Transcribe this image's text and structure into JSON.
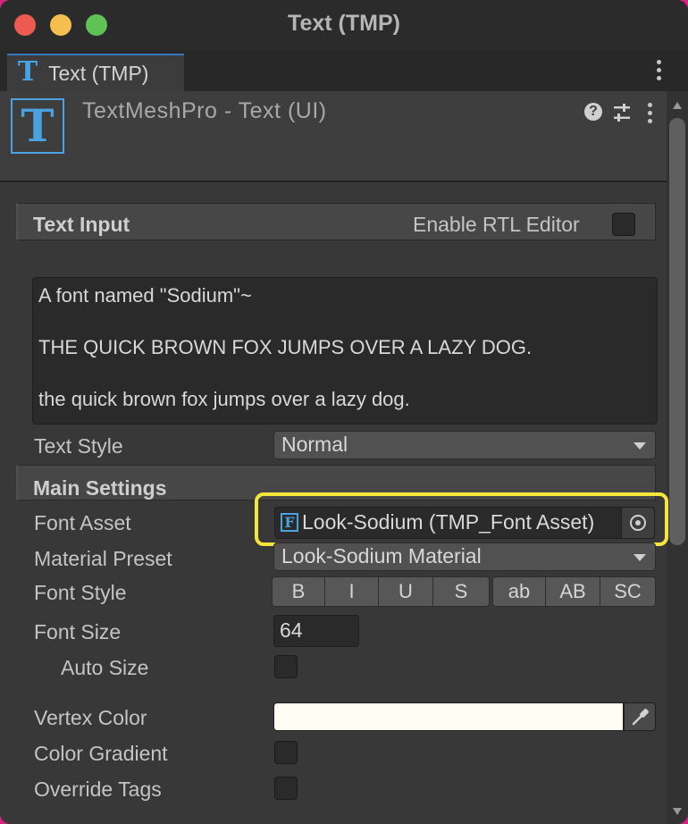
{
  "window": {
    "title": "Text (TMP)"
  },
  "tab": {
    "label": "Text (TMP)",
    "icon": "tmp-text-icon"
  },
  "component": {
    "title": "TextMeshPro - Text (UI)",
    "icon": "tmp-text-icon"
  },
  "text_input": {
    "section_title": "Text Input",
    "rtl_label": "Enable RTL Editor",
    "rtl_checked": false,
    "lines": [
      "A font named \"Sodium\"~",
      "THE QUICK BROWN FOX JUMPS OVER A LAZY DOG.",
      "the quick brown fox jumps over a lazy dog."
    ],
    "text_style_label": "Text Style",
    "text_style_value": "Normal"
  },
  "main_settings": {
    "section_title": "Main Settings",
    "font_asset_label": "Font Asset",
    "font_asset_value": "Look-Sodium (TMP_Font Asset)",
    "material_preset_label": "Material Preset",
    "material_preset_value": "Look-Sodium Material",
    "font_style_label": "Font Style",
    "font_style_buttons": [
      "B",
      "I",
      "U",
      "S",
      "ab",
      "AB",
      "SC"
    ],
    "font_size_label": "Font Size",
    "font_size_value": "64",
    "auto_size_label": "Auto Size",
    "auto_size_checked": false,
    "vertex_color_label": "Vertex Color",
    "vertex_color": "#fffcf4",
    "color_gradient_label": "Color Gradient",
    "color_gradient_checked": false,
    "override_tags_label": "Override Tags",
    "override_tags_checked": false
  },
  "colors": {
    "highlight": "#f3e53a",
    "accent": "#4aa3e0"
  }
}
